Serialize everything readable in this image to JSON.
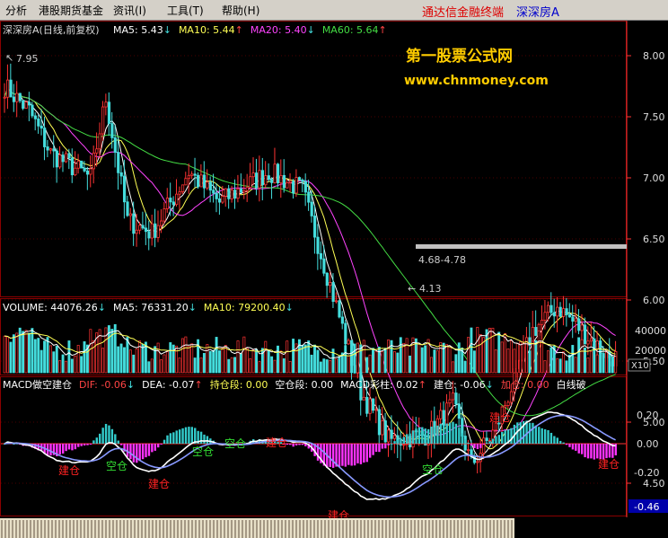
{
  "menu": {
    "items": [
      "分析",
      "港股期货基金",
      "资讯(I)",
      "工具(T)",
      "帮助(H)"
    ],
    "app_title": "通达信金融终端",
    "stock_title": "深深房A"
  },
  "price_panel": {
    "stock_label": "深深房A(日线,前复权)",
    "legend": [
      {
        "label": "MA5: 5.43",
        "arrow": "↓",
        "color": "#ffffff"
      },
      {
        "label": "MA10: 5.44",
        "arrow": "↑",
        "color": "#ffff55"
      },
      {
        "label": "MA20: 5.40",
        "arrow": "↓",
        "color": "#ff44ff"
      },
      {
        "label": "MA60: 5.64",
        "arrow": "↑",
        "color": "#44dd44"
      }
    ],
    "y_ticks": [
      "8.00",
      "7.50",
      "7.00",
      "6.50",
      "6.00",
      "5.50",
      "5.00",
      "4.50"
    ],
    "y_values": [
      8.0,
      7.5,
      7.0,
      6.5,
      6.0,
      5.5,
      5.0,
      4.5
    ],
    "annotations": {
      "high": "7.95",
      "low": "4.13",
      "range": "4.68-4.78"
    },
    "watermark_title": "第一股票公式网",
    "watermark_url": "www.chnmoney.com"
  },
  "volume_panel": {
    "legend": [
      {
        "label": "VOLUME: 44076.26",
        "arrow": "↓",
        "color": "#ffffff"
      },
      {
        "label": "MA5: 76331.20",
        "arrow": "↓",
        "color": "#ffffff"
      },
      {
        "label": "MA10: 79200.40",
        "arrow": "↓",
        "color": "#ffff55"
      }
    ],
    "y_ticks": [
      "40000",
      "20000"
    ],
    "multiplier": "X10"
  },
  "macd_panel": {
    "legend": [
      {
        "label": "MACD做空建仓",
        "arrow": "",
        "color": "#ffffff"
      },
      {
        "label": "DIF: -0.06",
        "arrow": "↓",
        "color": "#ff4444"
      },
      {
        "label": "DEA: -0.07",
        "arrow": "↑",
        "color": "#ffffff"
      },
      {
        "label": "持仓段: 0.00",
        "arrow": "",
        "color": "#ffff55"
      },
      {
        "label": "空仓段: 0.00",
        "arrow": "",
        "color": "#ffffff"
      },
      {
        "label": "MACD彩柱: 0.02",
        "arrow": "↑",
        "color": "#ffffff"
      },
      {
        "label": "建仓: -0.06",
        "arrow": "↓",
        "color": "#ffffff"
      },
      {
        "label": "加仓: 0.00",
        "arrow": "",
        "color": "#ff4444"
      },
      {
        "label": "白线破",
        "arrow": "",
        "color": "#ffffff"
      }
    ],
    "y_ticks": [
      "0.20",
      "0.00",
      "-0.20"
    ],
    "current": "-0.46",
    "signals": [
      {
        "text": "建仓",
        "color": "#ff2222"
      },
      {
        "text": "空仓",
        "color": "#33dd33"
      },
      {
        "text": "建仓",
        "color": "#ff2222"
      },
      {
        "text": "空仓",
        "color": "#33dd33"
      },
      {
        "text": "空仓",
        "color": "#33dd33"
      },
      {
        "text": "建仓",
        "color": "#ff2222"
      },
      {
        "text": "建仓",
        "color": "#ff2222"
      },
      {
        "text": "空仓",
        "color": "#33dd33"
      },
      {
        "text": "建仓",
        "color": "#ff2222"
      },
      {
        "text": "建仓",
        "color": "#ff2222"
      }
    ]
  },
  "colors": {
    "up": "#ff3333",
    "down": "#44dddd",
    "grid": "#8b0000",
    "axis": "#ff3333"
  }
}
